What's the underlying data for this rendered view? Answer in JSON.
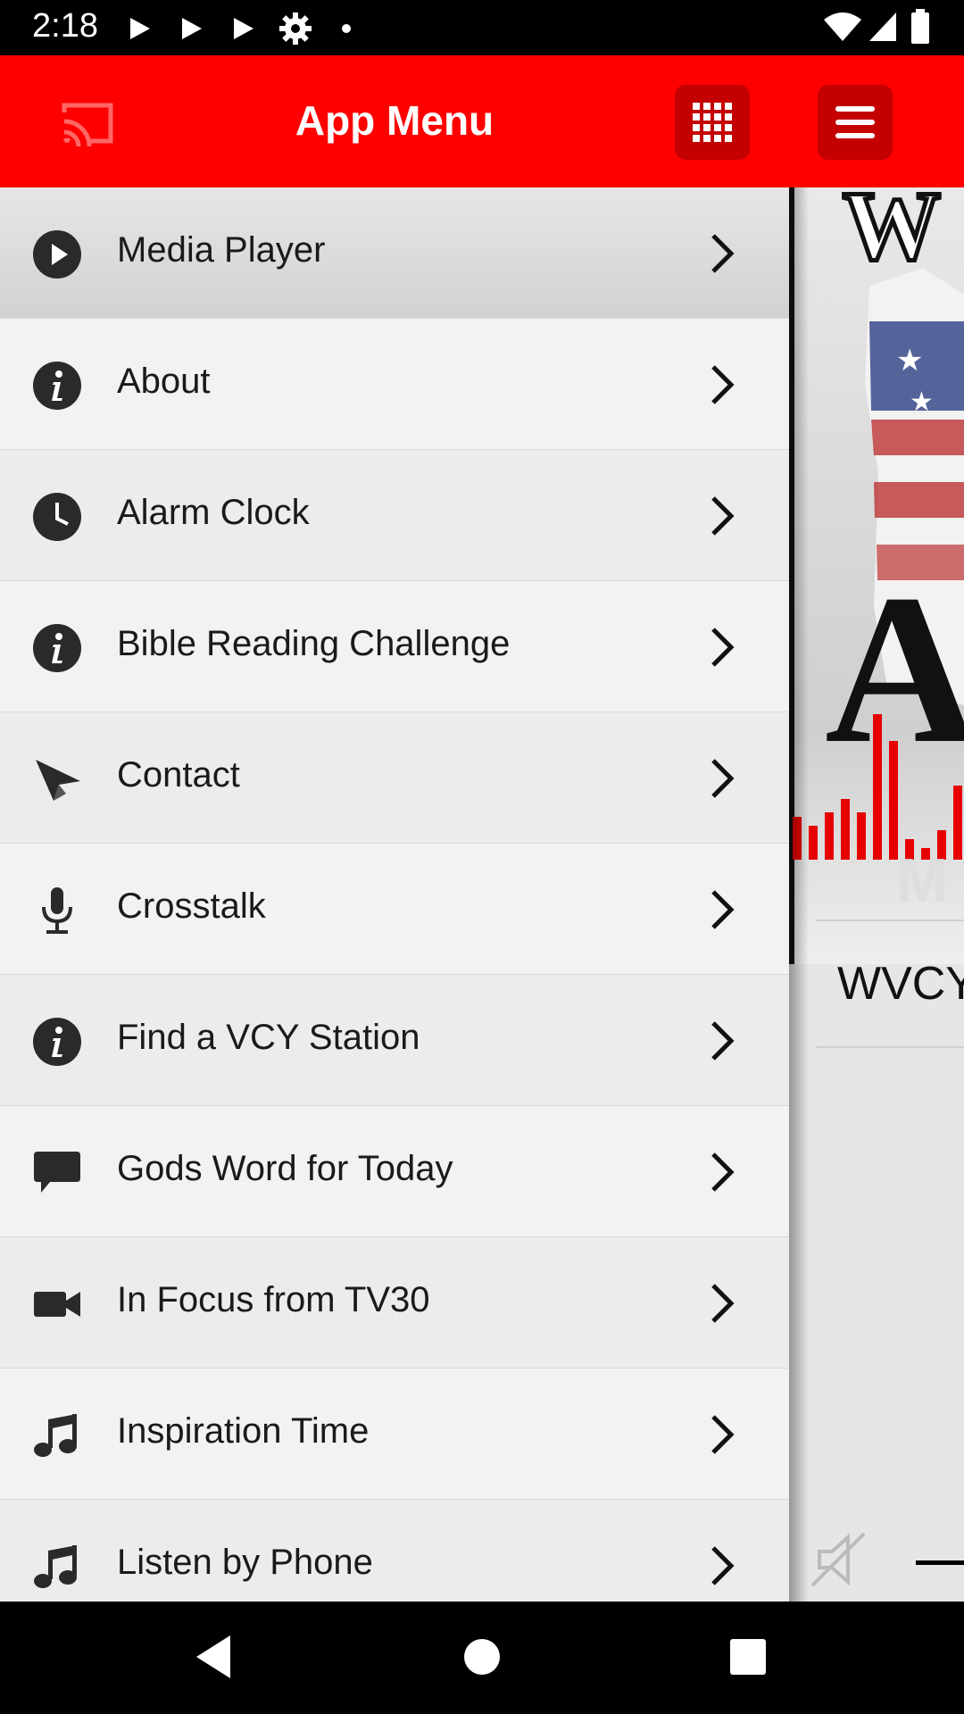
{
  "status_bar": {
    "time": "2:18",
    "left_icons": [
      "play-icon",
      "play-icon",
      "play-icon",
      "settings-icon",
      "dot-icon"
    ],
    "right_icons": [
      "wifi-icon",
      "signal-icon",
      "battery-icon"
    ]
  },
  "header": {
    "title": "App Menu",
    "cast_icon": "cast-icon",
    "grid_icon": "grid-icon",
    "menu_icon": "hamburger-icon",
    "color": "#ff0000",
    "button_color": "#c40000"
  },
  "menu": {
    "items": [
      {
        "label": "Media Player",
        "icon": "play-circle-icon"
      },
      {
        "label": "About",
        "icon": "info-icon"
      },
      {
        "label": "Alarm Clock",
        "icon": "clock-icon"
      },
      {
        "label": "Bible Reading Challenge",
        "icon": "info-icon"
      },
      {
        "label": "Contact",
        "icon": "send-icon"
      },
      {
        "label": "Crosstalk",
        "icon": "microphone-icon"
      },
      {
        "label": "Find a VCY Station",
        "icon": "info-icon"
      },
      {
        "label": "Gods Word for Today",
        "icon": "chat-bubble-icon"
      },
      {
        "label": "In Focus from TV30",
        "icon": "video-camera-icon"
      },
      {
        "label": "Inspiration Time",
        "icon": "music-note-icon"
      },
      {
        "label": "Listen by Phone",
        "icon": "music-note-icon"
      }
    ]
  },
  "player": {
    "station_label": "WVCY",
    "mute_icon": "mute-icon"
  },
  "nav_bar": {
    "buttons": [
      "back-icon",
      "home-icon",
      "recents-icon"
    ]
  }
}
